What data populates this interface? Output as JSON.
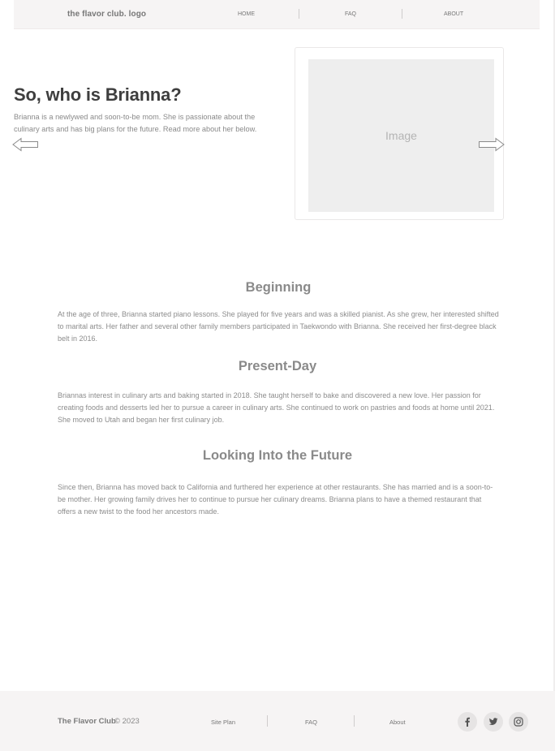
{
  "header": {
    "logo": "the flavor club. logo",
    "nav": [
      {
        "label": "HOME"
      },
      {
        "label": "FAQ"
      },
      {
        "label": "ABOUT"
      }
    ]
  },
  "hero": {
    "title": "So, who is Brianna?",
    "description": "Brianna is a newlywed and soon-to-be mom. She is passionate about the culinary arts and has big plans for the future. Read more about her below.",
    "image_label": "Image",
    "prev_icon": "arrow-left-icon",
    "next_icon": "arrow-right-icon"
  },
  "sections": [
    {
      "heading": "Beginning",
      "text": "At the age of three, Brianna started piano lessons. She played for five years and was a skilled pianist. As she grew, her interested shifted to marital arts. Her father and several other family members participated in Taekwondo with Brianna. She received her first-degree black belt in 2016."
    },
    {
      "heading": "Present-Day",
      "text": "Briannas interest in culinary arts and baking started in 2018. She taught herself to bake and discovered a new love. Her passion for creating foods and desserts led her to pursue a career in culinary arts. She continued to work on pastries and foods at home until 2021. She moved to Utah and began her first culinary job."
    },
    {
      "heading": "Looking Into the Future",
      "text": "Since then, Brianna has moved back to California and furthered her experience at other restaurants. She has married and is a soon-to-be mother. Her growing family drives her to continue to pursue her culinary dreams. Brianna plans to have a themed restaurant that offers a new twist to the food her ancestors made."
    }
  ],
  "footer": {
    "brand": "The Flavor Club",
    "copyright": "© 2023",
    "links": [
      {
        "label": "Site Plan"
      },
      {
        "label": "FAQ"
      },
      {
        "label": "About"
      }
    ],
    "social": [
      {
        "icon": "facebook-icon"
      },
      {
        "icon": "twitter-icon"
      },
      {
        "icon": "instagram-icon"
      }
    ]
  },
  "colors": {
    "header_bg": "#f6f4f4",
    "footer_bg": "#f6f4f4",
    "title": "#3e3e3e",
    "body_text": "#8c8c8c",
    "image_placeholder": "#eeeeee"
  }
}
